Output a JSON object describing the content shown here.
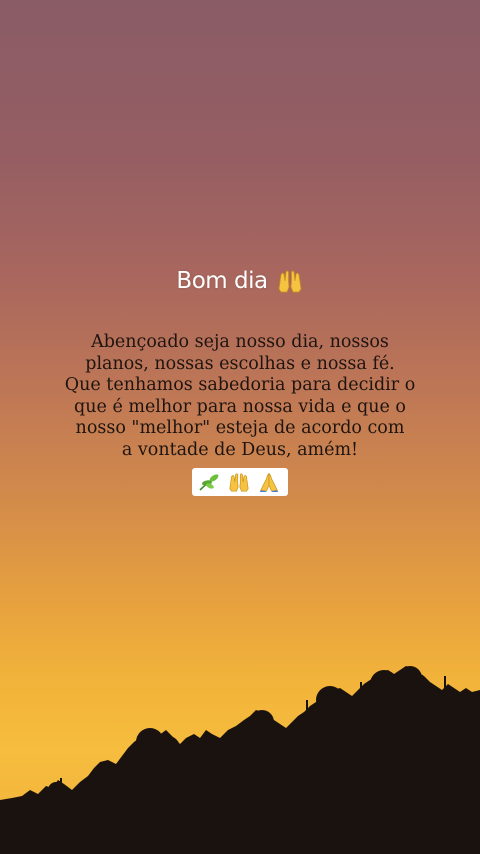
{
  "story": {
    "title": "Bom dia",
    "title_emoji": "raised-hands",
    "message_lines": [
      "Abençoado seja nosso dia, nossos",
      "planos, nossas escolhas e nossa fé.",
      "Que tenhamos sabedoria para decidir o",
      "que é melhor para nossa vida e que o",
      "nosso \"melhor\" esteja de acordo com",
      "a vontade de Deus, amém!"
    ],
    "emoji_sticker": [
      "herb",
      "raised-hands",
      "folded-hands"
    ]
  },
  "colors": {
    "sky_top": "#8a5c66",
    "sky_bottom": "#f6bd3e",
    "text": "#1e1410",
    "title": "#ffffff",
    "silhouette": "#1a120e"
  }
}
